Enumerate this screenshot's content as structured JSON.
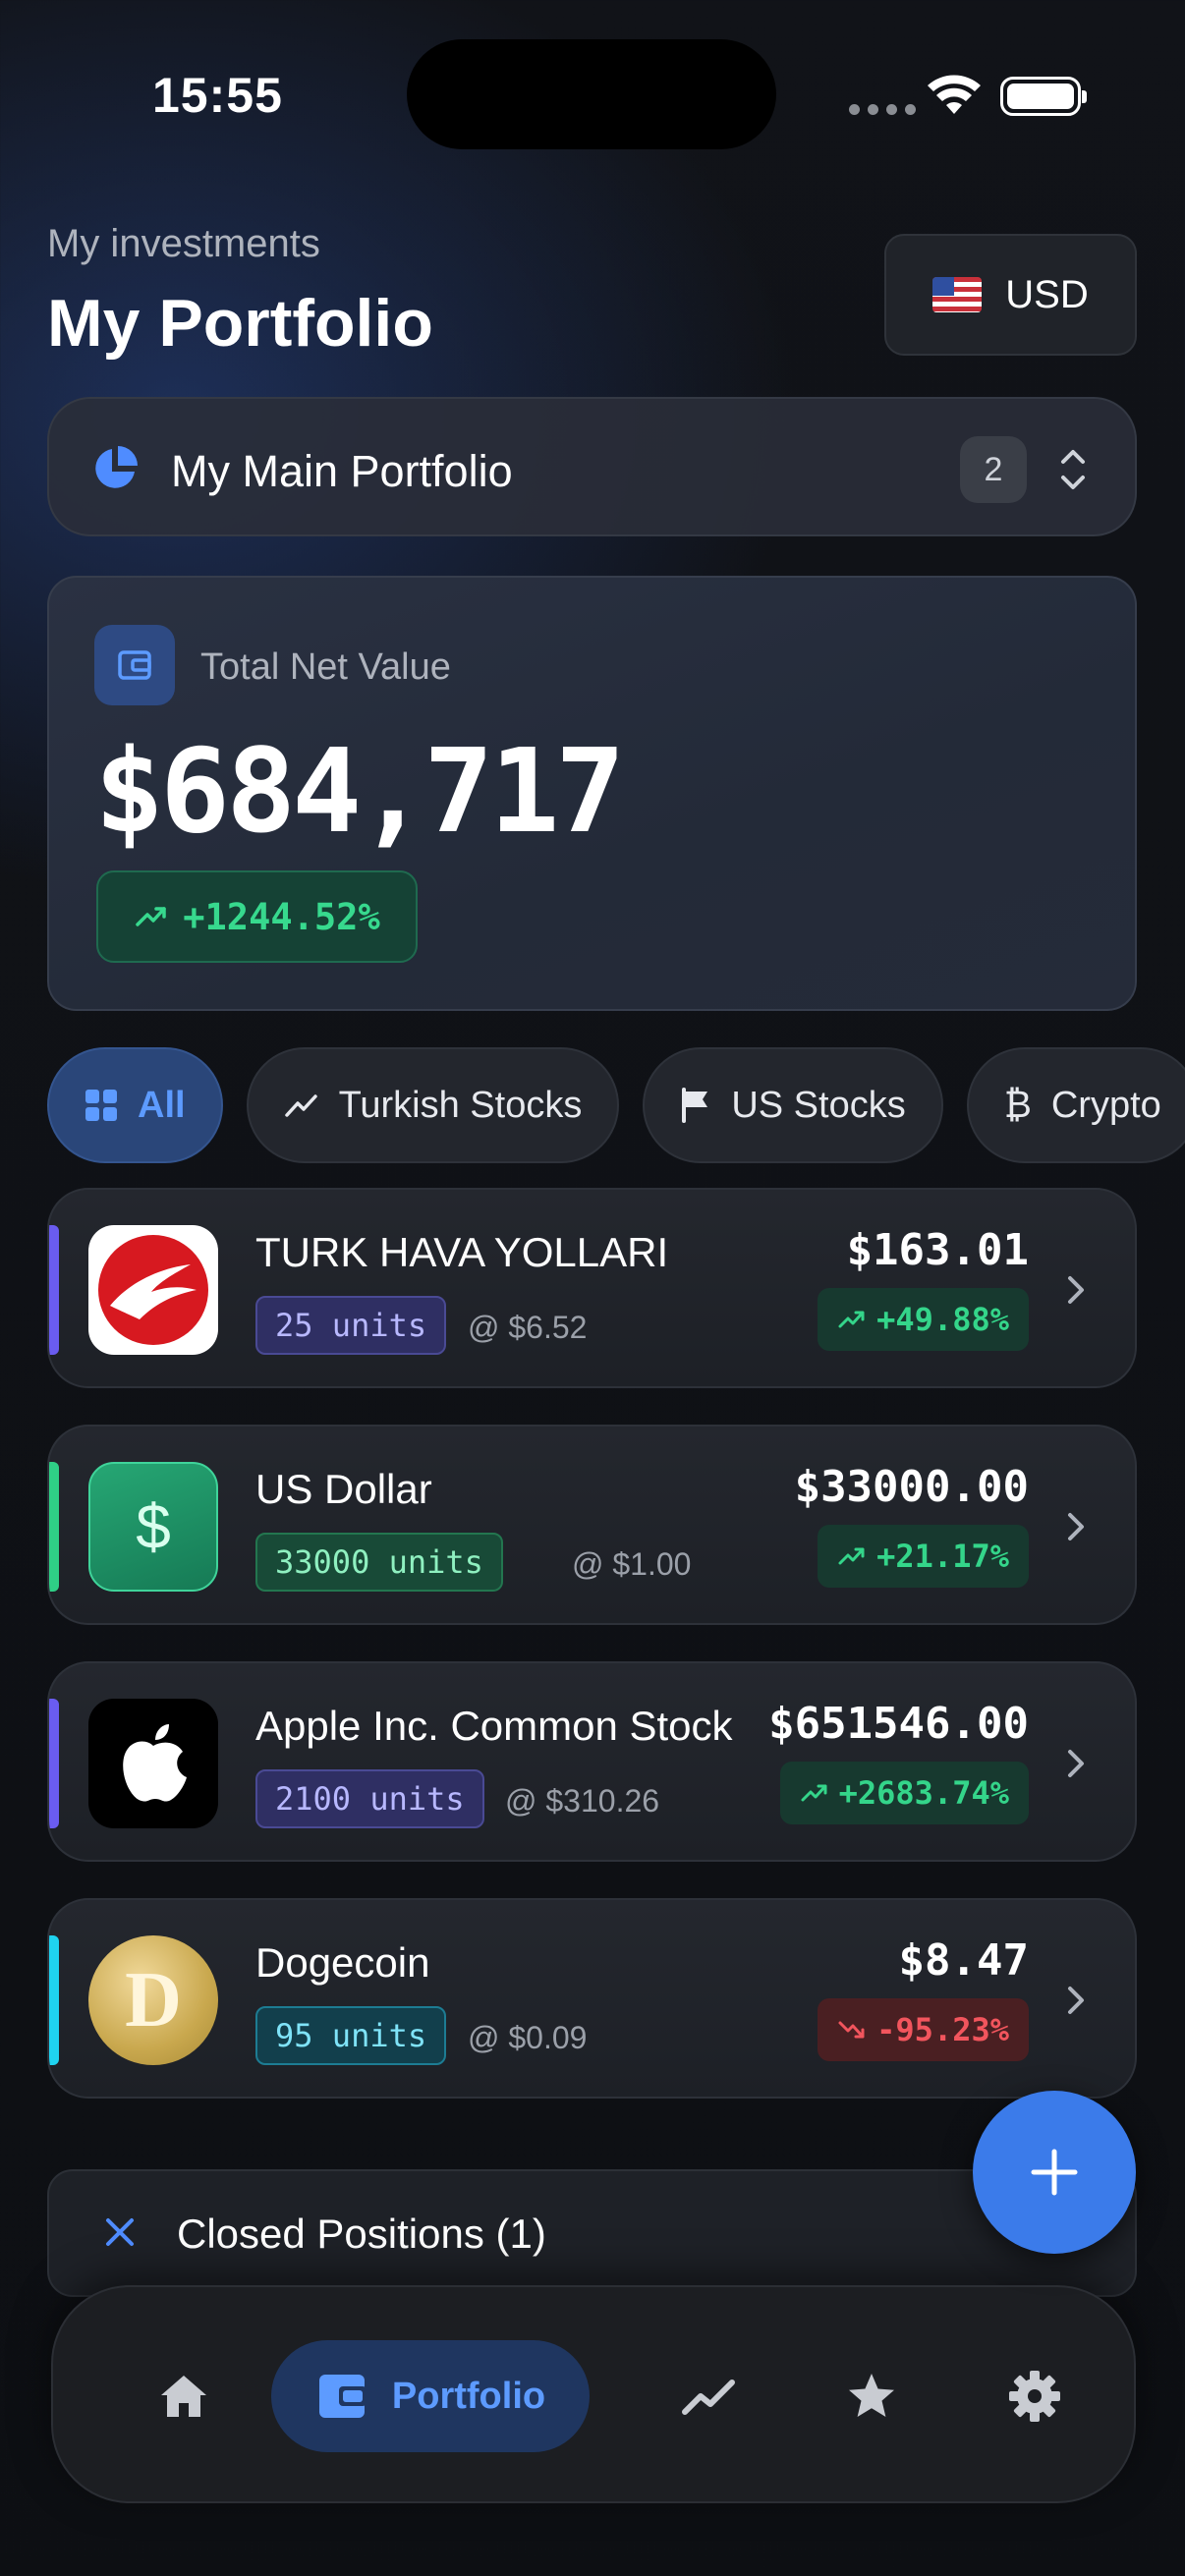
{
  "status_bar": {
    "time": "15:55"
  },
  "header": {
    "subtitle": "My investments",
    "title": "My Portfolio",
    "currency": "USD",
    "currency_flag_icon": "us-flag-icon"
  },
  "portfolio_selector": {
    "name": "My Main Portfolio",
    "count": "2"
  },
  "net_value": {
    "label": "Total Net Value",
    "value": "$684,717",
    "change": "+1244.52%"
  },
  "filters": [
    {
      "label": "All",
      "icon": "grid-icon",
      "active": true
    },
    {
      "label": "Turkish Stocks",
      "icon": "trend-up-icon",
      "active": false
    },
    {
      "label": "US Stocks",
      "icon": "flag-icon",
      "active": false
    },
    {
      "label": "Crypto",
      "icon": "bitcoin-icon",
      "active": false
    }
  ],
  "assets": [
    {
      "name": "TURK HAVA YOLLARI",
      "units": "25 units",
      "price": "@ $6.52",
      "value": "$163.01",
      "change": "+49.88%",
      "direction": "up",
      "accent": "#6a5cf0"
    },
    {
      "name": "US Dollar",
      "units": "33000 units",
      "price": "@ $1.00",
      "value": "$33000.00",
      "change": "+21.17%",
      "direction": "up",
      "accent": "#2fcf86"
    },
    {
      "name": "Apple Inc. Common Stock",
      "units": "2100 units",
      "price": "@ $310.26",
      "value": "$651546.00",
      "change": "+2683.74%",
      "direction": "up",
      "accent": "#6a5cf0"
    },
    {
      "name": "Dogecoin",
      "units": "95 units",
      "price": "@ $0.09",
      "value": "$8.47",
      "change": "-95.23%",
      "direction": "down",
      "accent": "#1fd3f0"
    }
  ],
  "closed_positions": {
    "label": "Closed Positions (1)"
  },
  "tabbar": {
    "items": [
      {
        "icon": "home-icon"
      },
      {
        "icon": "wallet-icon",
        "label": "Portfolio",
        "active": true
      },
      {
        "icon": "chart-icon"
      },
      {
        "icon": "star-icon"
      },
      {
        "icon": "gear-icon"
      }
    ]
  },
  "colors": {
    "accent": "#3b7bea",
    "positive": "#34d58a",
    "negative": "#f2555d"
  }
}
